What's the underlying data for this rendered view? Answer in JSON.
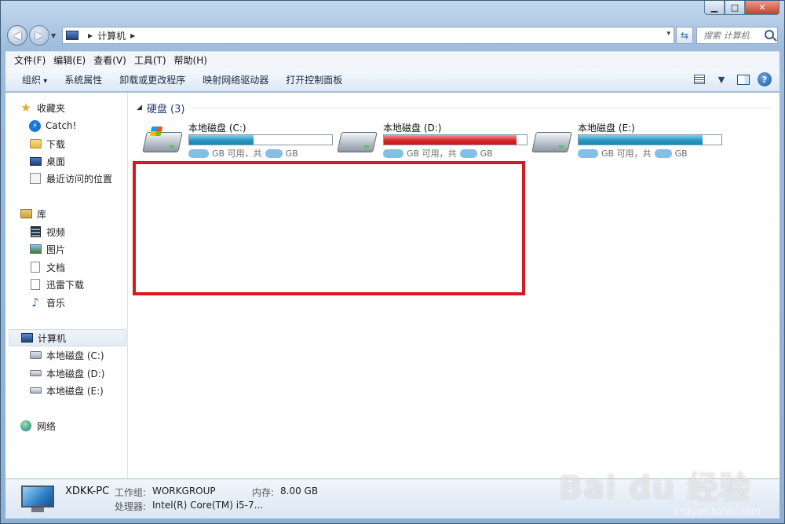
{
  "caption": {
    "min": "▁",
    "max": "□",
    "close": "✕"
  },
  "address": {
    "segment": "计算机",
    "dropdown": "▾"
  },
  "search": {
    "placeholder": "搜索 计算机"
  },
  "menu": [
    "文件(F)",
    "编辑(E)",
    "查看(V)",
    "工具(T)",
    "帮助(H)"
  ],
  "toolbar": {
    "buttons": [
      "组织",
      "系统属性",
      "卸载或更改程序",
      "映射网络驱动器",
      "打开控制面板"
    ],
    "help": "?"
  },
  "nav": {
    "favorites": {
      "label": "收藏夹",
      "items": [
        "Catch!",
        "下载",
        "桌面",
        "最近访问的位置"
      ]
    },
    "libraries": {
      "label": "库",
      "items": [
        "视频",
        "图片",
        "文档",
        "迅雷下载",
        "音乐"
      ]
    },
    "computer": {
      "label": "计算机",
      "items": [
        "本地磁盘 (C:)",
        "本地磁盘 (D:)",
        "本地磁盘 (E:)"
      ]
    },
    "network": {
      "label": "网络"
    }
  },
  "content": {
    "group_title": "硬盘 (3)",
    "drives": [
      {
        "name": "本地磁盘 (C:)",
        "used_fraction": 0.45,
        "bar_color": "#2a97c2",
        "space_mid": "GB 可用，共",
        "space_end": "GB"
      },
      {
        "name": "本地磁盘 (D:)",
        "used_fraction": 0.93,
        "bar_color": "#d9272b",
        "space_mid": "GB 可用，共",
        "space_end": "GB"
      },
      {
        "name": "本地磁盘 (E:)",
        "used_fraction": 0.87,
        "bar_color": "#2a97c2",
        "space_mid": "GB 可用，共",
        "space_end": "GB"
      }
    ]
  },
  "details": {
    "computer_name": "XDKK-PC",
    "workgroup_label": "工作组:",
    "workgroup": "WORKGROUP",
    "memory_label": "内存:",
    "memory": "8.00 GB",
    "processor_label": "处理器:",
    "processor": "Intel(R) Core(TM) i5-7..."
  },
  "watermark": {
    "brand": "Bai du 经验",
    "url": "jingyan.baidu.com"
  },
  "colors": {
    "highlight": "#d51a1f"
  }
}
